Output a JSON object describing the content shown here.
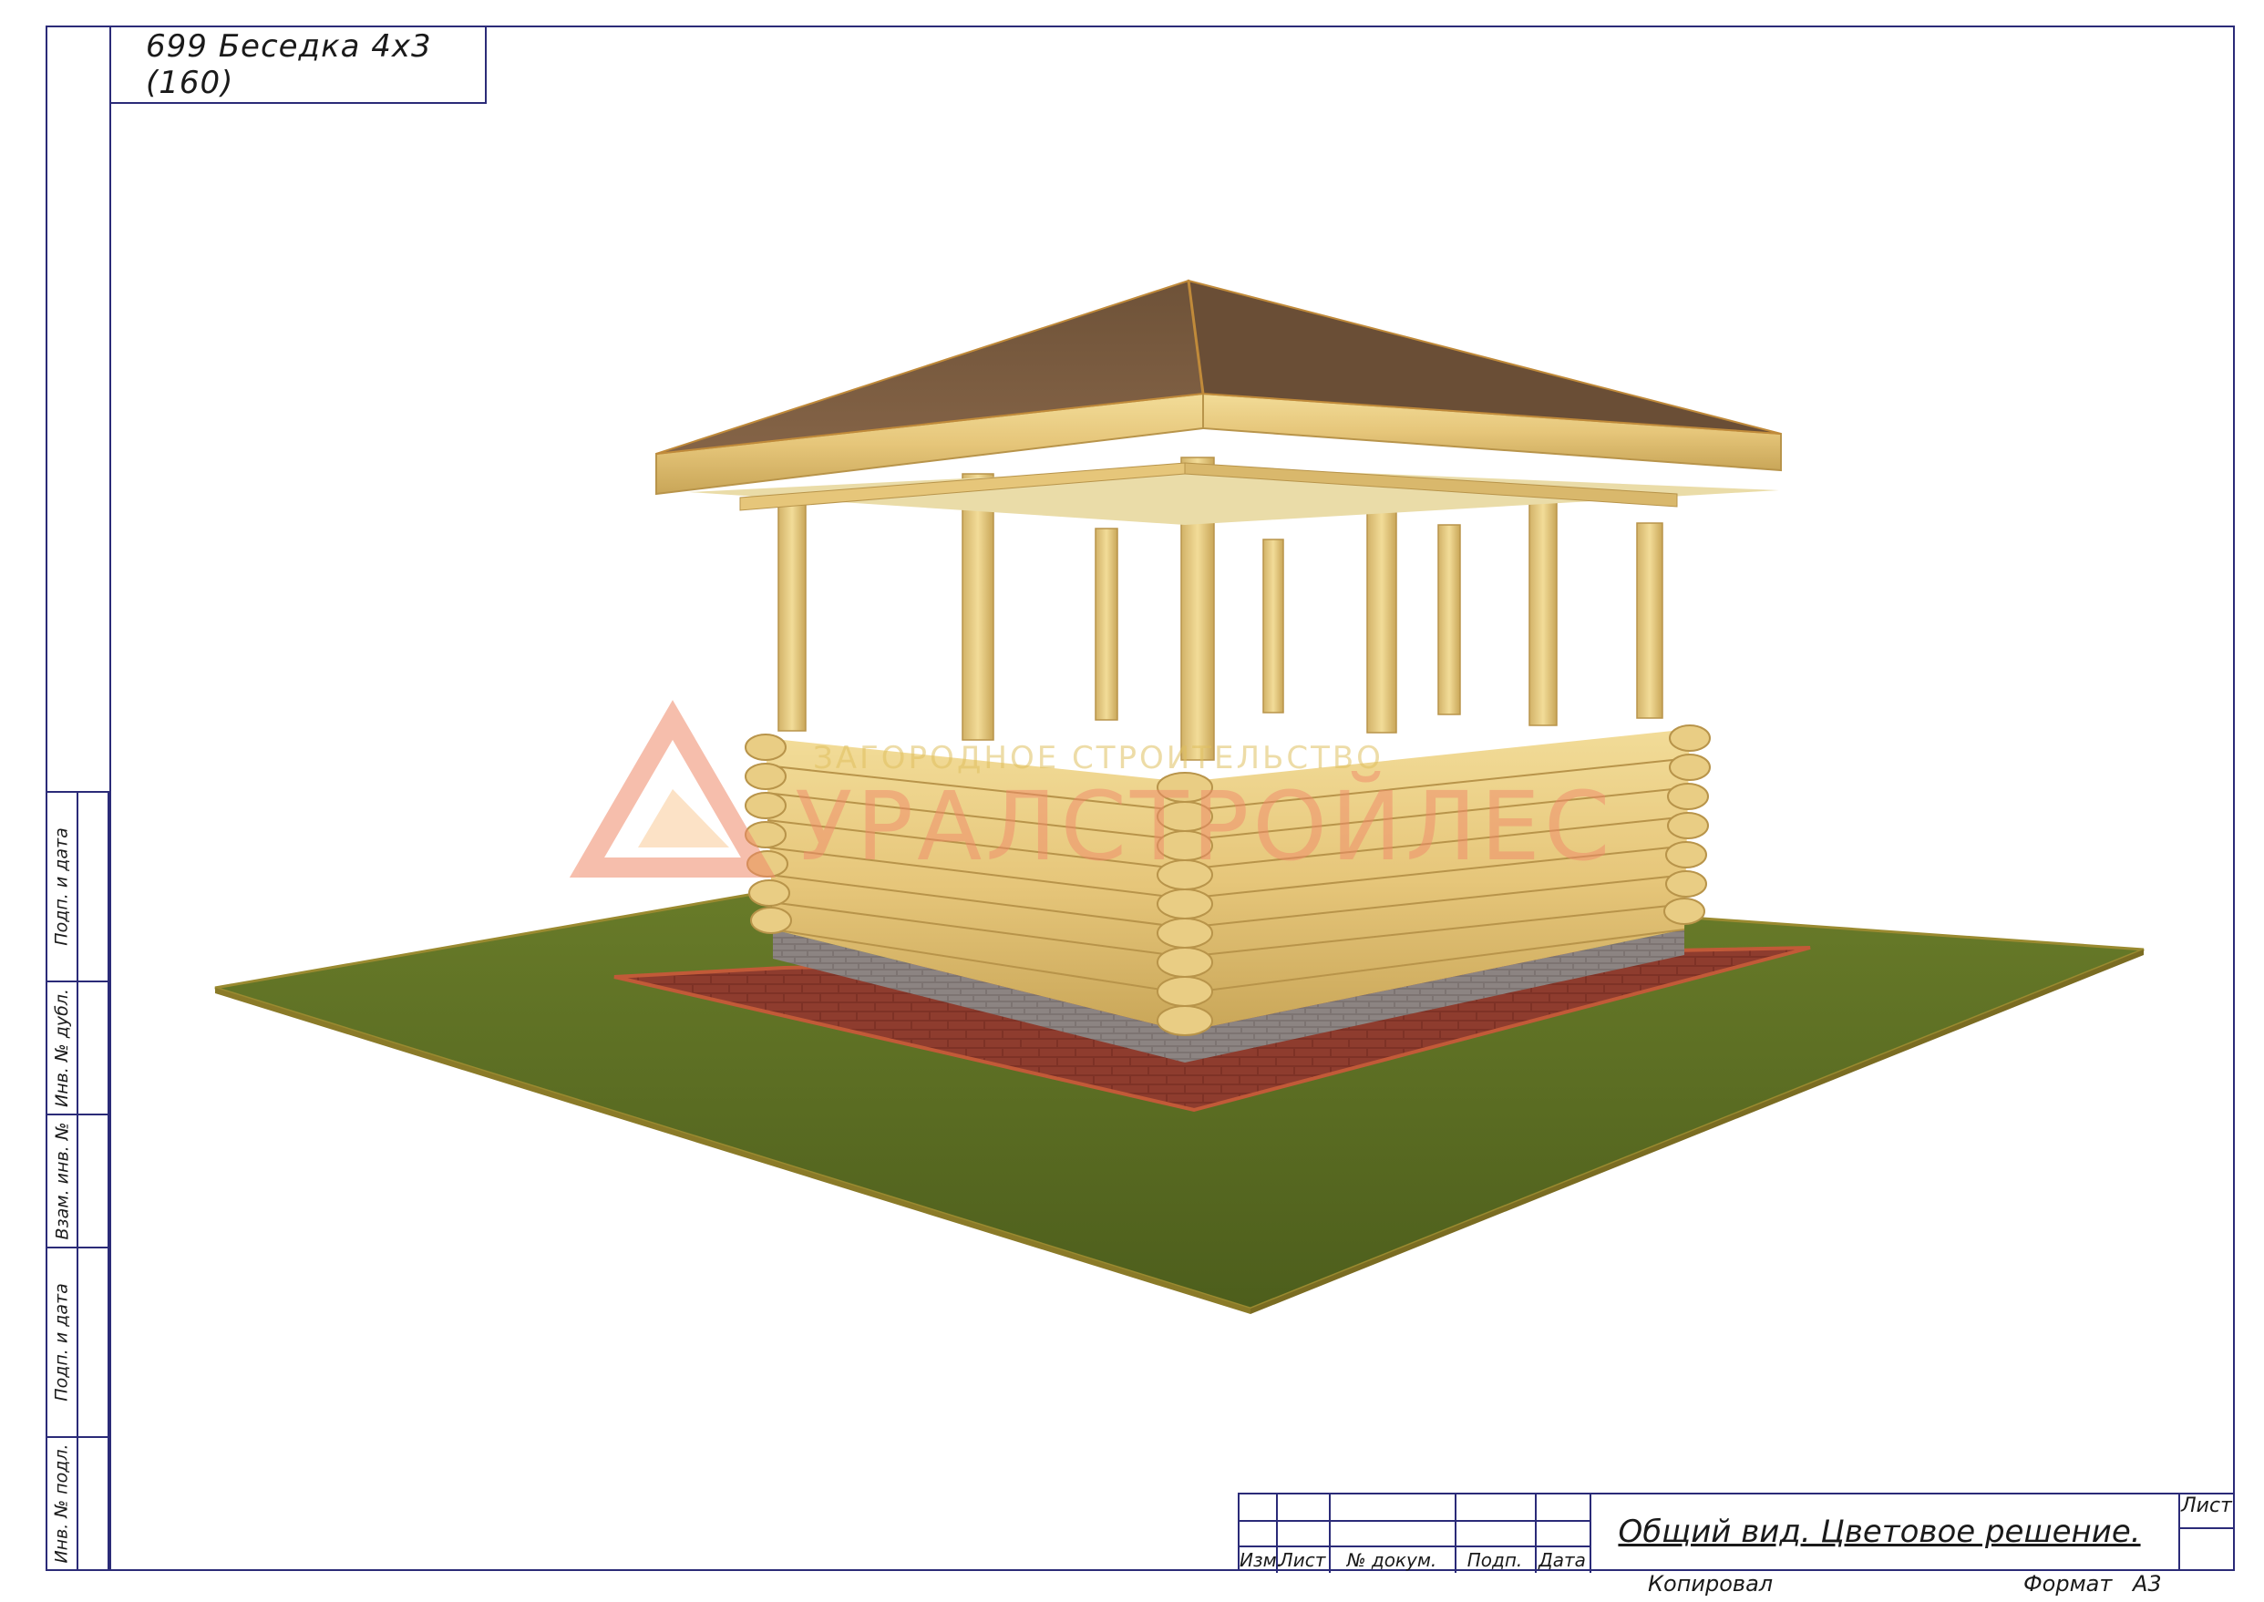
{
  "sheet": {
    "title": "699 Беседка 4х3 (160)"
  },
  "side_strip": {
    "labels": [
      "Подп. и дата",
      "Инв. № дубл.",
      "Взам. инв. №",
      "Подп. и дата",
      "Инв. № подл."
    ]
  },
  "stamp": {
    "headers": [
      "Изм.",
      "Лист",
      "№ докум.",
      "Подп.",
      "Дата"
    ],
    "title": "Общий вид. Цветовое решение.",
    "sheet_label": "Лист"
  },
  "footer": {
    "copied_label": "Копировал",
    "format_label": "Формат",
    "format_value": "А3"
  },
  "watermark": {
    "brand": "УРАЛСТРОЙЛЕС",
    "tagline": "ЗАГОРОДНОЕ СТРОИТЕЛЬСТВО"
  },
  "colors": {
    "frame": "#2b2b78",
    "grass": "#5b6e22",
    "paving": "#8a3a2c",
    "log": "#e3c67a",
    "roof": "#7a5a3c",
    "watermark": "#f08a6a"
  }
}
